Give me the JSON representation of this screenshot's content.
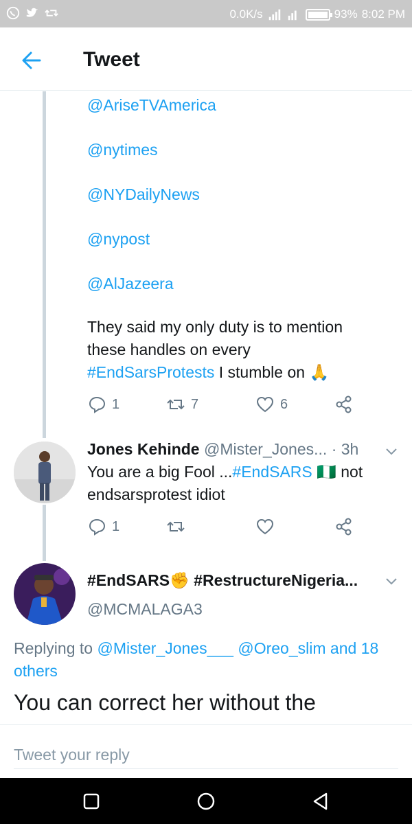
{
  "status": {
    "speed": "0.0K/s",
    "network": "4G",
    "battery": "93%",
    "time": "8:02 PM"
  },
  "header": {
    "title": "Tweet"
  },
  "tweet1": {
    "mentions": [
      "@AriseTVAmerica",
      "@nytimes",
      "@NYDailyNews",
      "@nypost",
      "@AlJazeera"
    ],
    "text_lines": [
      "They said my only duty is to mention",
      "these handles on every"
    ],
    "hashtag": "#EndSarsProtests",
    "text_tail": "I stumble on",
    "emoji": "🙏",
    "replies": "1",
    "retweets": "7",
    "likes": "6"
  },
  "tweet2": {
    "name": "Jones Kehinde",
    "handle": "@Mister_Jones...",
    "time": "· 3h",
    "text_start": "You are a big Fool ...",
    "hashtag": "#EndSARS",
    "emoji": "🇳🇬",
    "text_end": "not",
    "text_line2": "endsarsprotest idiot",
    "replies": "1"
  },
  "tweet3": {
    "name_tag1": "#EndSARS",
    "name_emoji": "✊",
    "name_tag2": "#RestructureNigeria...",
    "handle": "@MCMALAGA3",
    "replying_label": "Replying to",
    "reply_user1": "@Mister_Jones___",
    "reply_user2": "@Oreo_slim",
    "reply_others": "and 18 others",
    "text": "You can correct her without the"
  },
  "reply": {
    "placeholder": "Tweet your reply"
  },
  "colors": {
    "accent": "#1da1f2",
    "text": "#14171a",
    "secondary": "#657786"
  }
}
